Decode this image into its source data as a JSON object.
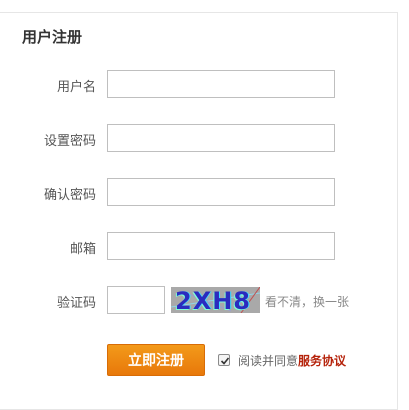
{
  "form": {
    "title": "用户注册",
    "fields": [
      {
        "label": "用户名",
        "value": ""
      },
      {
        "label": "设置密码",
        "value": ""
      },
      {
        "label": "确认密码",
        "value": ""
      },
      {
        "label": "邮箱",
        "value": ""
      }
    ],
    "captcha": {
      "label": "验证码",
      "value": "",
      "image_text": "2XH8",
      "refresh_text": "看不清，换一张"
    },
    "submit_label": "立即注册",
    "agreement": {
      "checked": true,
      "prefix": "阅读并同意",
      "link_text": "服务协议"
    }
  },
  "colors": {
    "button": "#f08c14",
    "agreement_link": "#b5220a"
  }
}
